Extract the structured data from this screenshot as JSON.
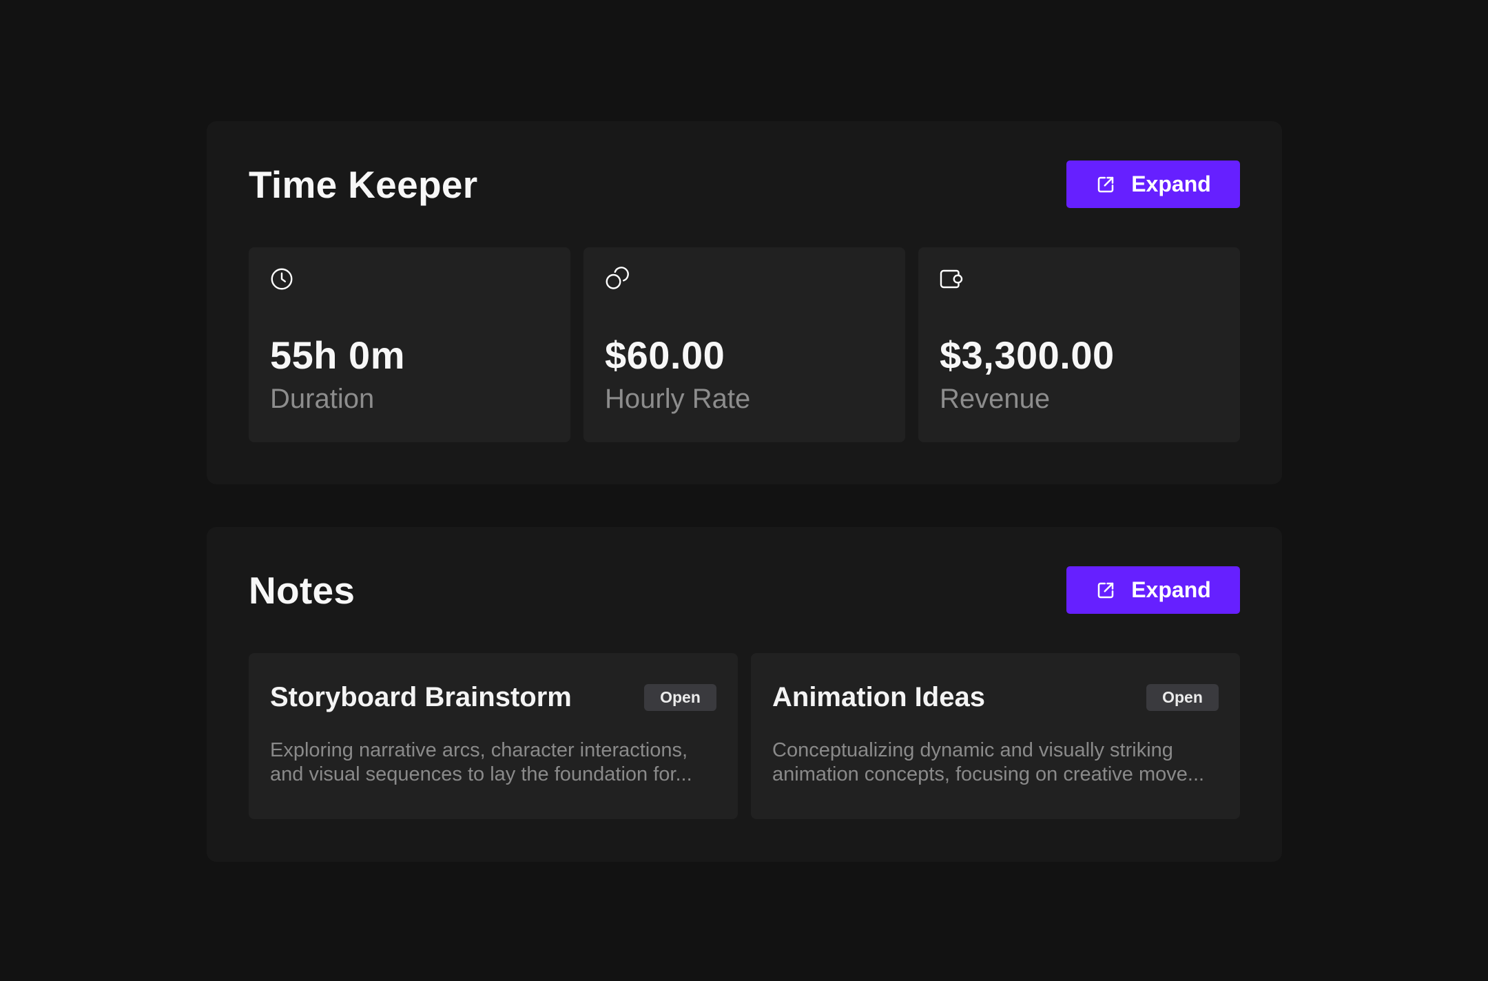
{
  "time_keeper": {
    "title": "Time Keeper",
    "expand_label": "Expand",
    "stats": [
      {
        "icon": "clock-icon",
        "value": "55h 0m",
        "label": "Duration"
      },
      {
        "icon": "coins-icon",
        "value": "$60.00",
        "label": "Hourly Rate"
      },
      {
        "icon": "wallet-icon",
        "value": "$3,300.00",
        "label": "Revenue"
      }
    ]
  },
  "notes": {
    "title": "Notes",
    "expand_label": "Expand",
    "items": [
      {
        "title": "Storyboard Brainstorm",
        "badge": "Open",
        "description": "Exploring narrative arcs, character interactions, and visual sequences to lay the foundation for..."
      },
      {
        "title": "Animation Ideas",
        "badge": "Open",
        "description": "Conceptualizing dynamic and visually striking animation concepts, focusing on creative move..."
      }
    ]
  },
  "colors": {
    "background": "#121212",
    "panel": "#181818",
    "card": "#212121",
    "accent": "#6620ff",
    "badge": "#3a3a3e"
  }
}
